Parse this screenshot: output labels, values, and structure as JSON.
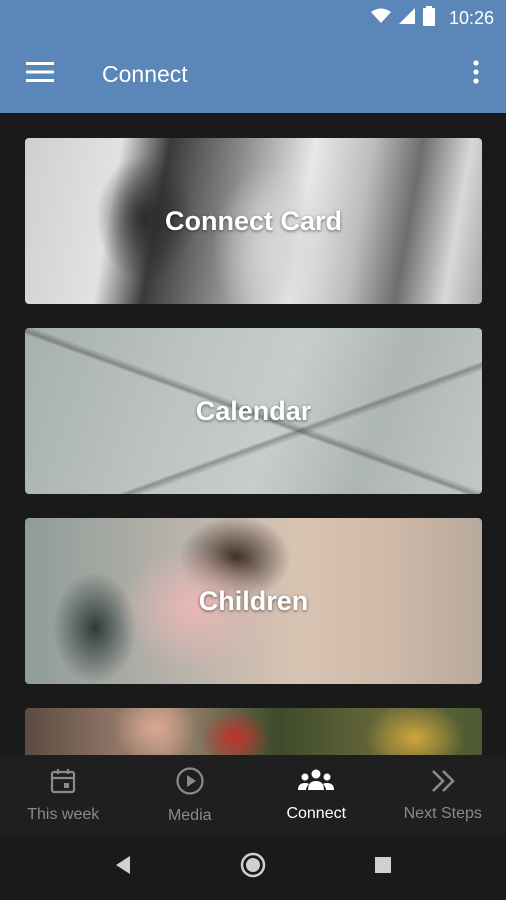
{
  "status_bar": {
    "time": "10:26"
  },
  "app_bar": {
    "title": "Connect"
  },
  "cards": [
    {
      "label": "Connect Card"
    },
    {
      "label": "Calendar"
    },
    {
      "label": "Children"
    },
    {
      "label": ""
    }
  ],
  "bottom_nav": {
    "items": [
      {
        "label": "This week",
        "icon": "calendar-icon",
        "active": false
      },
      {
        "label": "Media",
        "icon": "play-circle-icon",
        "active": false
      },
      {
        "label": "Connect",
        "icon": "group-icon",
        "active": true
      },
      {
        "label": "Next Steps",
        "icon": "double-chevron-right-icon",
        "active": false
      }
    ]
  },
  "colors": {
    "app_bar": "#5b87b8",
    "background": "#1a1a1a",
    "nav_inactive": "#8a8a8a",
    "nav_active": "#ffffff"
  }
}
